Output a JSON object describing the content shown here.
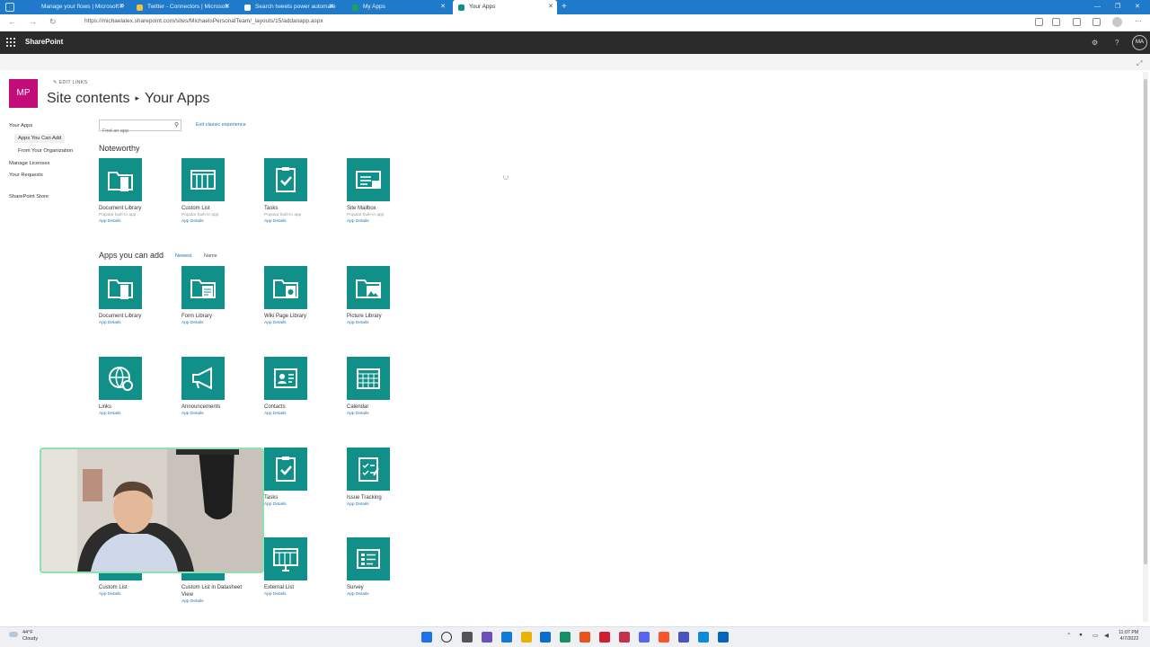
{
  "browser": {
    "tabs": [
      {
        "title": "Manage your flows | Microsoft P",
        "favicon_color": "#2f6fd8"
      },
      {
        "title": "Twitter - Connectors | Microsoft",
        "favicon_color": "#f3c13a"
      },
      {
        "title": "Search tweets power automate",
        "favicon_color": "#ffffff"
      },
      {
        "title": "My Apps",
        "favicon_color": "#1aa260"
      },
      {
        "title": "Your Apps",
        "favicon_color": "#11908a"
      }
    ],
    "active_tab": 4,
    "new_tab_label": "+",
    "window_controls": [
      "—",
      "❐",
      "✕"
    ],
    "url": "https://michaelalex.sharepoint.com/sites/MichaelsPersonalTeam/_layouts/15/addanapp.aspx",
    "nav_glyphs": {
      "back": "←",
      "forward": "→",
      "refresh": "↻"
    }
  },
  "suitebar": {
    "brand": "SharePoint",
    "settings_glyph": "⚙",
    "help_glyph": "?",
    "user_initials": "MA"
  },
  "header": {
    "site_logo_text": "MP",
    "edit_links": "EDIT LINKS",
    "title_part1": "Site contents",
    "separator": "▸",
    "title_part2": "Your Apps",
    "focus_glyph": "⤢"
  },
  "leftnav": {
    "items": [
      {
        "label": "Your Apps"
      },
      {
        "label": "Apps You Can Add"
      },
      {
        "label": "From Your Organization"
      },
      {
        "label": "Manage Licenses"
      },
      {
        "label": "Your Requests"
      },
      {
        "label": "SharePoint Store"
      }
    ]
  },
  "search": {
    "placeholder": "Find an app",
    "icon_glyph": "⚲"
  },
  "exit_classic": "Exit classic experience",
  "noteworthy": {
    "heading": "Noteworthy",
    "apps": [
      {
        "name": "Document Library",
        "desc": "Popular built-in app",
        "details": "App Details",
        "icon": "document-library-icon"
      },
      {
        "name": "Custom List",
        "desc": "Popular built-in app",
        "details": "App Details",
        "icon": "custom-list-icon"
      },
      {
        "name": "Tasks",
        "desc": "Popular built-in app",
        "details": "App Details",
        "icon": "tasks-icon"
      },
      {
        "name": "Site Mailbox",
        "desc": "Popular built-in app",
        "details": "App Details",
        "icon": "site-mailbox-icon"
      }
    ]
  },
  "apps_you_can_add": {
    "heading": "Apps you can add",
    "sort_newest": "Newest",
    "sort_name": "Name",
    "apps": [
      {
        "name": "Document Library",
        "details": "App Details",
        "icon": "document-library-icon"
      },
      {
        "name": "Form Library",
        "details": "App Details",
        "icon": "form-library-icon"
      },
      {
        "name": "Wiki Page Library",
        "details": "App Details",
        "icon": "wiki-page-library-icon"
      },
      {
        "name": "Picture Library",
        "details": "App Details",
        "icon": "picture-library-icon"
      },
      {
        "name": "Links",
        "details": "App Details",
        "icon": "links-icon"
      },
      {
        "name": "Announcements",
        "details": "App Details",
        "icon": "announcements-icon"
      },
      {
        "name": "Contacts",
        "details": "App Details",
        "icon": "contacts-icon"
      },
      {
        "name": "Calendar",
        "details": "App Details",
        "icon": "calendar-icon"
      },
      {
        "name": "Tasks",
        "details": "App Details",
        "icon": "tasks-icon"
      },
      {
        "name": "Issue Tracking",
        "details": "App Details",
        "icon": "issue-tracking-icon"
      },
      {
        "name": "Custom List",
        "details": "App Details",
        "icon": "custom-list-icon"
      },
      {
        "name": "Custom List in Datasheet",
        "name2": "View",
        "details": "App Details",
        "icon": "datasheet-list-icon"
      },
      {
        "name": "External List",
        "details": "App Details",
        "icon": "external-list-icon"
      },
      {
        "name": "Survey",
        "details": "App Details",
        "icon": "survey-icon"
      }
    ]
  },
  "taskbar": {
    "weather_temp": "44°F",
    "weather_desc": "Cloudy",
    "time": "11:07 PM",
    "date": "4/7/2022",
    "apps": [
      "#1a73e8",
      "#333333",
      "#555555",
      "#6b4fbb",
      "#0f7bd7",
      "#e8b400",
      "#0a6ed1",
      "#1a8f66",
      "#e8541c",
      "#d11f2f",
      "#c4314b",
      "#5865f2",
      "#fb542b",
      "#4b53bc",
      "#0c8bd9",
      "#0364b8"
    ]
  },
  "colors": {
    "tile": "#11908a",
    "suitebar": "#2b2b2b",
    "site_logo": "#c30b7a",
    "link": "#1e74b8",
    "tab_strip": "#1f7ac9"
  }
}
